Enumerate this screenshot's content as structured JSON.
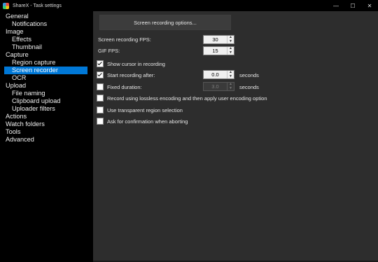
{
  "window": {
    "title": "ShareX - Task settings",
    "minimize": "—",
    "maximize": "☐",
    "close": "✕"
  },
  "sidebar": {
    "items": [
      {
        "label": "General",
        "level": 0
      },
      {
        "label": "Notifications",
        "level": 1
      },
      {
        "label": "Image",
        "level": 0
      },
      {
        "label": "Effects",
        "level": 1
      },
      {
        "label": "Thumbnail",
        "level": 1
      },
      {
        "label": "Capture",
        "level": 0
      },
      {
        "label": "Region capture",
        "level": 1
      },
      {
        "label": "Screen recorder",
        "level": 1,
        "selected": true
      },
      {
        "label": "OCR",
        "level": 1
      },
      {
        "label": "Upload",
        "level": 0
      },
      {
        "label": "File naming",
        "level": 1
      },
      {
        "label": "Clipboard upload",
        "level": 1
      },
      {
        "label": "Uploader filters",
        "level": 1
      },
      {
        "label": "Actions",
        "level": 0
      },
      {
        "label": "Watch folders",
        "level": 0
      },
      {
        "label": "Tools",
        "level": 0
      },
      {
        "label": "Advanced",
        "level": 0
      }
    ]
  },
  "main": {
    "options_button": "Screen recording options...",
    "fps_label": "Screen recording FPS:",
    "fps_value": "30",
    "gif_fps_label": "GIF FPS:",
    "gif_fps_value": "15",
    "show_cursor": {
      "label": "Show cursor in recording",
      "checked": true
    },
    "start_after": {
      "label": "Start recording after:",
      "checked": true,
      "value": "0.0",
      "unit": "seconds"
    },
    "fixed_duration": {
      "label": "Fixed duration:",
      "checked": false,
      "value": "3.0",
      "unit": "seconds"
    },
    "lossless": {
      "label": "Record using lossless encoding and then apply user encoding option",
      "checked": false
    },
    "transparent": {
      "label": "Use transparent region selection",
      "checked": false
    },
    "confirm_abort": {
      "label": "Ask for confirmation when aborting",
      "checked": false
    }
  },
  "colors": {
    "selection": "#0078d7",
    "sidebar_bg": "#000000",
    "panel_bg": "#2d2d2d"
  }
}
